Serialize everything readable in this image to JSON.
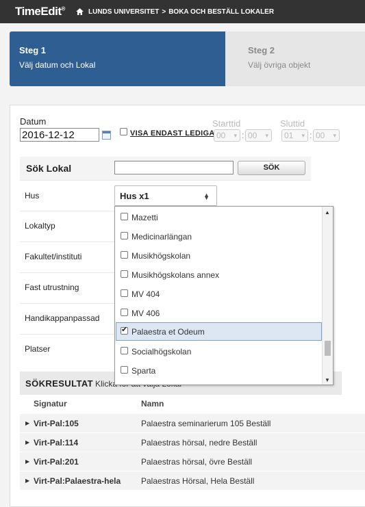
{
  "header": {
    "logo": "TimeEdit",
    "logo_mark": "®",
    "breadcrumb": [
      "LUNDS UNIVERSITET",
      ">",
      "BOKA OCH BESTÄLL LOKALER"
    ]
  },
  "steps": [
    {
      "title": "Steg 1",
      "subtitle": "Välj datum och Lokal",
      "active": true
    },
    {
      "title": "Steg 2",
      "subtitle": "Välj övriga objekt",
      "active": false
    }
  ],
  "form": {
    "date_label": "Datum",
    "date_value": "2016-12-12",
    "only_free_label": "VISA ENDAST LEDIGA",
    "only_free_checked": false,
    "start_label": "Starttid",
    "start_hour": "00",
    "start_min": "00",
    "end_label": "Sluttid",
    "end_hour": "01",
    "end_min": "00",
    "colon": ":"
  },
  "search": {
    "title": "Sök Lokal",
    "input_value": "",
    "button": "SÖK"
  },
  "filters": {
    "hus_label": "Hus",
    "hus_value": "Hus x1",
    "rows": [
      "Lokaltyp",
      "Fakultet/instituti",
      "Fast utrustning",
      "Handikappanpassad",
      "Platser"
    ]
  },
  "dropdown": {
    "options": [
      {
        "label": "Mazetti",
        "checked": false
      },
      {
        "label": "Medicinarlängan",
        "checked": false
      },
      {
        "label": "Musikhögskolan",
        "checked": false
      },
      {
        "label": "Musikhögskolans annex",
        "checked": false
      },
      {
        "label": "MV 404",
        "checked": false
      },
      {
        "label": "MV 406",
        "checked": false
      },
      {
        "label": "Palaestra et Odeum",
        "checked": true
      },
      {
        "label": "Socialhögskolan",
        "checked": false
      },
      {
        "label": "Sparta",
        "checked": false
      }
    ]
  },
  "results": {
    "title": "SÖKRESULTAT",
    "hint": "Klicka för att välja Lokal",
    "col_signatur": "Signatur",
    "col_namn": "Namn",
    "rows": [
      {
        "sig": "Virt-Pal:105",
        "name": "Palaestra seminarierum 105 Beställ"
      },
      {
        "sig": "Virt-Pal:114",
        "name": "Palaestras hörsal, nedre Beställ"
      },
      {
        "sig": "Virt-Pal:201",
        "name": "Palaestras hörsal, övre Beställ"
      },
      {
        "sig": "Virt-Pal:Palaestra-hela",
        "name": "Palaestras Hörsal, Hela Beställ"
      }
    ]
  },
  "colors": {
    "accent": "#2f5e92",
    "topbar": "#333333"
  }
}
